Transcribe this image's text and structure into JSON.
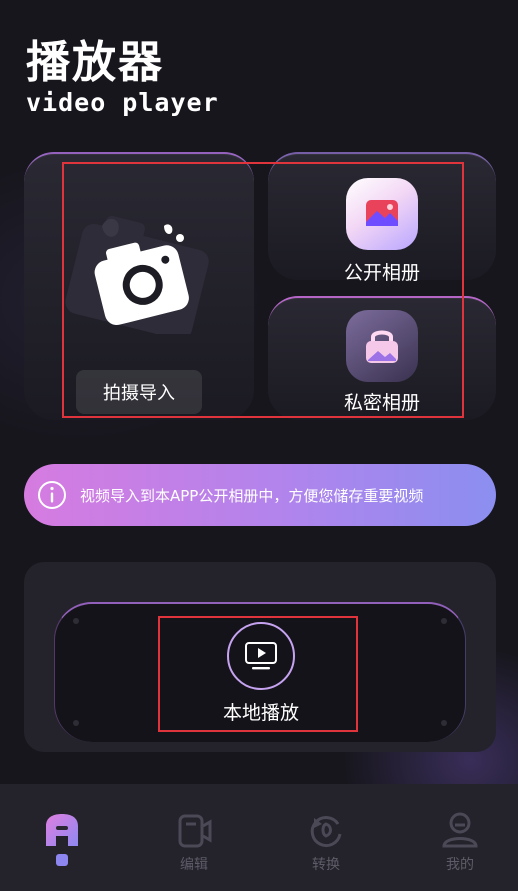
{
  "header": {
    "title": "播放器",
    "subtitle": "video player"
  },
  "import_card": {
    "button_label": "拍摄导入",
    "icon": "camera-icon"
  },
  "albums": {
    "public_label": "公开相册",
    "public_icon": "image-album-icon",
    "private_label": "私密相册",
    "private_icon": "lock-album-icon"
  },
  "tip": {
    "icon": "info-icon",
    "text": "视频导入到本APP公开相册中，方便您储存重要视频"
  },
  "local_play": {
    "label": "本地播放",
    "icon": "play-screen-icon"
  },
  "tabs": [
    {
      "label": "",
      "icon": "home-icon",
      "active": true
    },
    {
      "label": "编辑",
      "icon": "edit-video-icon",
      "active": false
    },
    {
      "label": "转换",
      "icon": "convert-icon",
      "active": false
    },
    {
      "label": "我的",
      "icon": "profile-icon",
      "active": false
    }
  ],
  "colors": {
    "background": "#17161d",
    "accent_gradient_start": "#d67be0",
    "accent_gradient_end": "#8b8ef0",
    "active_tab": "#8e86f0",
    "inactive_tab": "#5d5c68",
    "highlight_box": "#e0343c"
  }
}
